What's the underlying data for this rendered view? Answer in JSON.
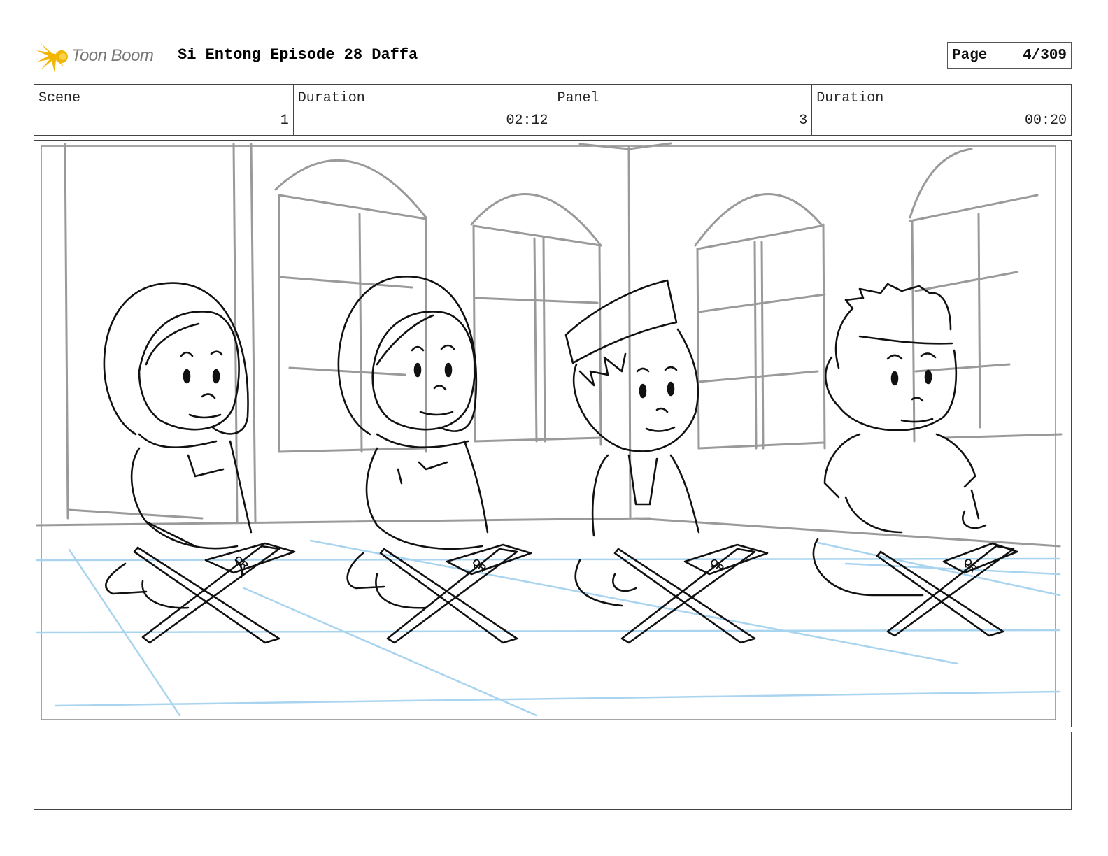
{
  "header": {
    "logo_text": "Toon Boom",
    "logo_icon": "star-burst-icon",
    "project_title": "Si Entong Episode 28 Daffa",
    "page_label": "Page",
    "page_value": "4/309"
  },
  "info": {
    "scene_label": "Scene",
    "scene_value": "1",
    "scene_duration_label": "Duration",
    "scene_duration_value": "02:12",
    "panel_label": "Panel",
    "panel_value": "3",
    "panel_duration_label": "Duration",
    "panel_duration_value": "00:20"
  },
  "panel": {
    "book_marking": "QR"
  },
  "notes": {
    "text": ""
  },
  "colors": {
    "sketch_line": "#111111",
    "background_line": "#9a9a9a",
    "floor_guide": "#a9d4ef",
    "logo_accent": "#f2b705"
  }
}
